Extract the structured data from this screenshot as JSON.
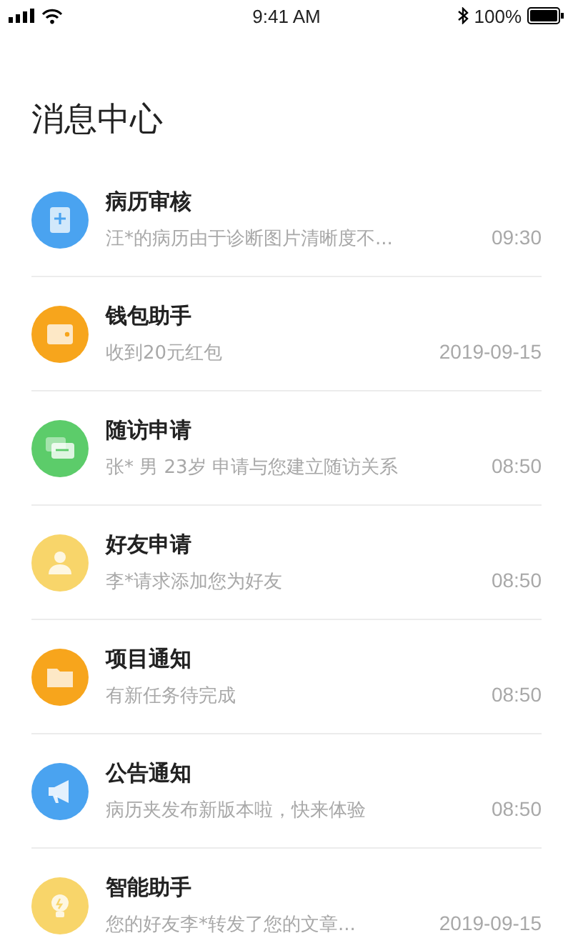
{
  "status_bar": {
    "time": "9:41 AM",
    "battery": "100%"
  },
  "title": "消息中心",
  "messages": [
    {
      "kind": "clipboard",
      "color": "#4aa3f0",
      "title": "病历审核",
      "preview": "汪*的病历由于诊断图片清晰度不...",
      "time": "09:30"
    },
    {
      "kind": "wallet",
      "color": "#f7a51c",
      "title": "钱包助手",
      "preview": "收到20元红包",
      "time": "2019-09-15"
    },
    {
      "kind": "chat",
      "color": "#5ccc6a",
      "title": "随访申请",
      "preview": "张* 男 23岁 申请与您建立随访关系",
      "time": "08:50"
    },
    {
      "kind": "people",
      "color": "#f8d56a",
      "title": "好友申请",
      "preview": "李*请求添加您为好友",
      "time": "08:50"
    },
    {
      "kind": "folder",
      "color": "#f7a51c",
      "title": "项目通知",
      "preview": "有新任务待完成",
      "time": "08:50"
    },
    {
      "kind": "megaphone",
      "color": "#4aa3f0",
      "title": "公告通知",
      "preview": "病历夹发布新版本啦，快来体验",
      "time": "08:50"
    },
    {
      "kind": "bulb",
      "color": "#f8d56a",
      "title": "智能助手",
      "preview": "您的好友李*转发了您的文章...",
      "time": "2019-09-15"
    }
  ]
}
